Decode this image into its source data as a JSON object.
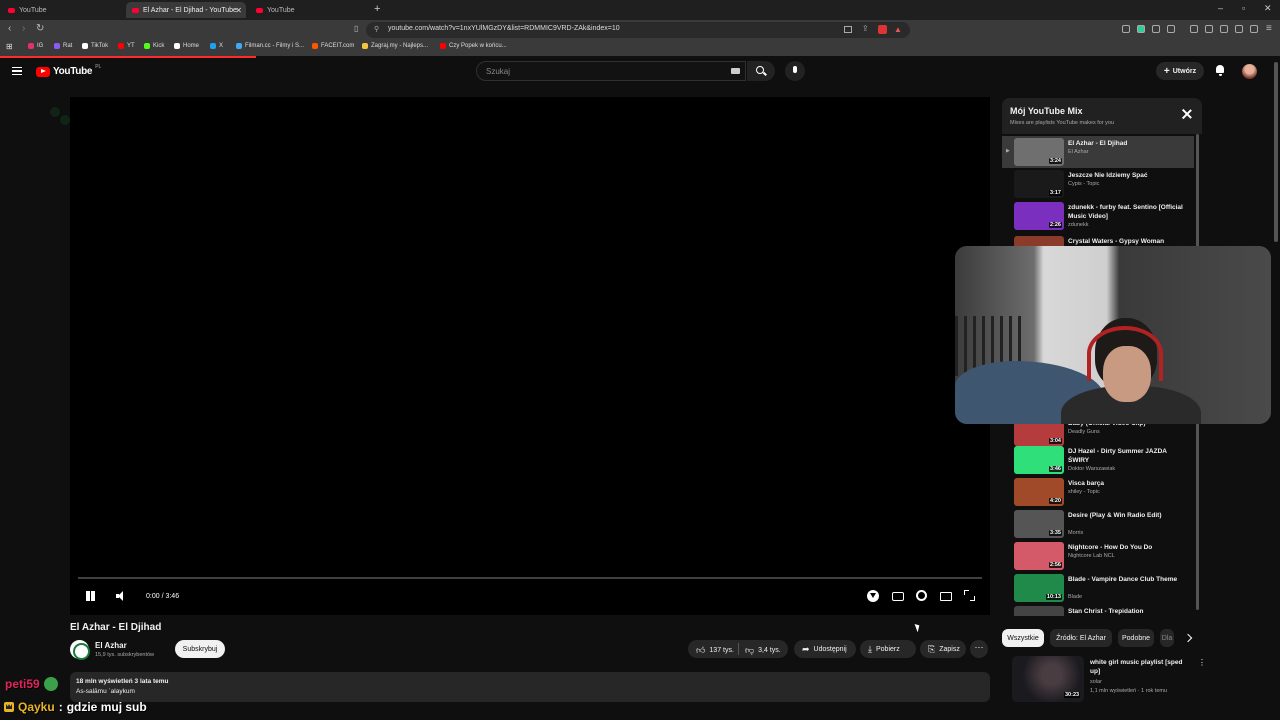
{
  "browser": {
    "tabs": [
      {
        "title": "YouTube"
      },
      {
        "title": "El Azhar - El Djihad - YouTube",
        "active": true
      },
      {
        "title": "YouTube"
      }
    ],
    "new_tab": "+",
    "window_controls": [
      "–",
      "▫",
      "✕"
    ],
    "url": "youtube.com/watch?v=1nxYUlMGzDY&list=RDMMIC9VRD-ZAk&index=10",
    "bookmarks": [
      {
        "label": "IG",
        "color": "#e1306c"
      },
      {
        "label": "Rat",
        "color": "#8a5cf6"
      },
      {
        "label": "TikTok",
        "color": "#ffffff"
      },
      {
        "label": "YT",
        "color": "#ff0000"
      },
      {
        "label": "Kick",
        "color": "#53fc18"
      },
      {
        "label": "Home",
        "color": "#ffffff"
      },
      {
        "label": "X",
        "color": "#1da1f2"
      },
      {
        "label": "Filman.cc - Filmy i S...",
        "color": "#3fa9f5"
      },
      {
        "label": "FACEIT.com",
        "color": "#ff5500"
      },
      {
        "label": "Zagraj.my - Najleps...",
        "color": "#f5c542"
      },
      {
        "label": "Czy Popek w końcu...",
        "color": "#ff0000"
      }
    ]
  },
  "masthead": {
    "logo_text": "YouTube",
    "country": "PL",
    "search_placeholder": "Szukaj",
    "create_label": "Utwórz"
  },
  "player": {
    "time": "0:00 / 3:46",
    "progress": 0.0
  },
  "video": {
    "title": "El Azhar - El Djihad",
    "channel": "El Azhar",
    "subscribers": "15,9 tys. subskrybentów",
    "subscribe_label": "Subskrybuj",
    "likes": "137 tys.",
    "dislikes": "3,4 tys.",
    "share_label": "Udostępnij",
    "download_label": "Pobierz",
    "save_label": "Zapisz",
    "views": "18 mln wyświetleń  3 lata temu",
    "description": "As-salāmu ʿalaykum"
  },
  "chat": [
    {
      "user": "peti59",
      "separator": ":",
      "message": ""
    },
    {
      "user": "Qayku",
      "separator": ":",
      "message": "gdzie muj sub"
    }
  ],
  "playlist": {
    "title": "Mój YouTube Mix",
    "subtitle": "Mixes are playlists YouTube makes for you",
    "now_playing_marker": "▶",
    "items": [
      {
        "title": "El Azhar - El Djihad",
        "channel": "El Azhar",
        "duration": "3:24",
        "thumb": "#6f6f6f",
        "active": true
      },
      {
        "title": "Jeszcze Nie Idziemy Spać",
        "channel": "Cypis - Topic",
        "duration": "3:17",
        "thumb": "#1a1a1a"
      },
      {
        "title": "zdunekk - furby feat. Sentino [Official Music Video]",
        "channel": "zdunekk",
        "duration": "2:26",
        "thumb": "#7a2fbf"
      },
      {
        "title": "Crystal Waters - Gypsy Woman",
        "channel": "",
        "duration": "",
        "thumb": "#8b3b2a"
      },
      {
        "title": "Baby (Official Video Clip)",
        "channel": "Deadly Guns",
        "duration": "3:04",
        "thumb": "#b43c3c"
      },
      {
        "title": "DJ Hazel - Dirty Summer JAZDA ŚWIRY",
        "channel": "Doktor Warszawiak",
        "duration": "3:46",
        "thumb": "#2fe07a"
      },
      {
        "title": "Visca barça",
        "channel": "shiley - Topic",
        "duration": "4:20",
        "thumb": "#a04a2a"
      },
      {
        "title": "Desire (Play & Win Radio Edit)",
        "channel": "Morris",
        "duration": "3:35",
        "thumb": "#555555"
      },
      {
        "title": "Nightcore - How Do You Do",
        "channel": "Nightcore Lab NCL",
        "duration": "2:56",
        "thumb": "#d45a6a"
      },
      {
        "title": "Blade - Vampire Dance Club Theme",
        "channel": "Blade",
        "duration": "10:13",
        "thumb": "#1f8a4a"
      },
      {
        "title": "Stan Christ - Trepidation",
        "channel": "",
        "duration": "",
        "thumb": "#444444"
      }
    ]
  },
  "chips": [
    "Wszystkie",
    "Źródło: El Azhar",
    "Podobne",
    "Dla"
  ],
  "recommendation": {
    "title": "white girl music playlist [sped up]",
    "channel": "solar",
    "meta": "1,1 mln wyświetleń · 1 rok temu",
    "duration": "30:23"
  }
}
